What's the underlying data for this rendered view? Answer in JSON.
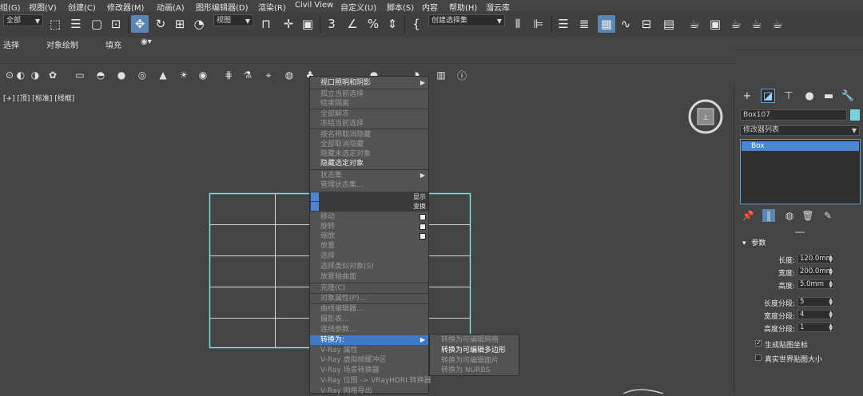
{
  "menu": [
    "组(G)",
    "视图(V)",
    "创建(C)",
    "修改器(M)",
    "动画(A)",
    "图形编辑器(D)",
    "渲染(R)",
    "Civil View",
    "自定义(U)",
    "脚本(S)",
    "内容",
    "帮助(H)",
    "溜云库"
  ],
  "toolbar": {
    "filter_dropdown": "全部",
    "coord_dropdown": "视图",
    "selset_dropdown": "创建选择集"
  },
  "ribbon": {
    "select": "选择",
    "object_paint": "对象绘制",
    "populate": "填充"
  },
  "viewport": {
    "label": "[+] [顶] [标准] [线框]"
  },
  "context_menu": {
    "items": [
      {
        "label": "视口照明和阴影",
        "enabled": true,
        "submenu": true
      },
      {
        "label": "孤立当前选择",
        "enabled": false
      },
      {
        "label": "结束隔离",
        "enabled": false
      },
      {
        "label": "全部解冻",
        "enabled": false
      },
      {
        "label": "冻结当前选择",
        "enabled": false
      },
      {
        "label": "按名称取消隐藏",
        "enabled": false
      },
      {
        "label": "全部取消隐藏",
        "enabled": false
      },
      {
        "label": "隐藏未选定对象",
        "enabled": false
      },
      {
        "label": "隐藏选定对象",
        "enabled": true
      },
      {
        "label": "状态集",
        "enabled": false,
        "submenu": true
      },
      {
        "label": "管理状态集...",
        "enabled": false
      },
      {
        "label": "移动",
        "enabled": false
      },
      {
        "label": "旋转",
        "enabled": false
      },
      {
        "label": "缩放",
        "enabled": false
      },
      {
        "label": "放置",
        "enabled": false
      },
      {
        "label": "选择",
        "enabled": false
      },
      {
        "label": "选择类似对象(S)",
        "enabled": false
      },
      {
        "label": "放置轴曲面",
        "enabled": false
      },
      {
        "label": "克隆(C)",
        "enabled": false
      },
      {
        "label": "对象属性(P)...",
        "enabled": false
      },
      {
        "label": "曲线编辑器...",
        "enabled": false
      },
      {
        "label": "摄影表...",
        "enabled": false
      },
      {
        "label": "连线参数...",
        "enabled": false
      },
      {
        "label": "转换为:",
        "enabled": true,
        "submenu": true
      },
      {
        "label": "V-Ray 属性",
        "enabled": false
      },
      {
        "label": "V-Ray 虚拟帧缓冲区",
        "enabled": false
      },
      {
        "label": "V-Ray 场景转换器",
        "enabled": false
      },
      {
        "label": "V-Ray 位图 -> VRayHDRI 转换器",
        "enabled": false
      },
      {
        "label": "V-Ray 网格导出",
        "enabled": false
      }
    ],
    "quad_display": "显示",
    "quad_transform": "变换"
  },
  "submenu": {
    "items": [
      {
        "label": "转换为可编辑网格",
        "enabled": false
      },
      {
        "label": "转换为可编辑多边形",
        "enabled": true
      },
      {
        "label": "转换为可编辑面片",
        "enabled": false
      },
      {
        "label": "转换为 NURBS",
        "enabled": false
      }
    ]
  },
  "command_panel": {
    "object_name": "Box107",
    "object_color": "#7ad3dc",
    "modifier_list": "修改器列表",
    "stack_item": "Box",
    "rollout_title": "参数",
    "params": [
      {
        "label": "长度:",
        "value": "120.0mm"
      },
      {
        "label": "宽度:",
        "value": "200.0mm"
      },
      {
        "label": "高度:",
        "value": "5.0mm"
      },
      {
        "label": "长度分段:",
        "value": "5"
      },
      {
        "label": "宽度分段:",
        "value": "4"
      },
      {
        "label": "高度分段:",
        "value": "1"
      }
    ],
    "checkboxes": [
      {
        "label": "生成贴图坐标",
        "checked": true
      },
      {
        "label": "真实世界贴图大小",
        "checked": false
      }
    ]
  },
  "colors": {
    "accent": "#5a86b5",
    "highlight": "#3f78c5",
    "box_wire": "#7de2e6"
  }
}
